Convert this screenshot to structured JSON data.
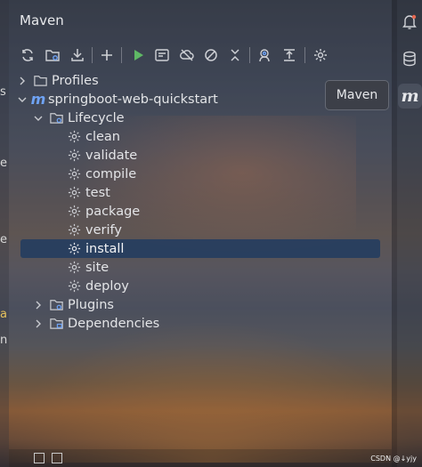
{
  "panel": {
    "title": "Maven"
  },
  "toolbar": {
    "buttons": [
      {
        "name": "reload-icon"
      },
      {
        "name": "generate-sources-icon"
      },
      {
        "name": "download-icon"
      },
      {
        "name": "add-icon"
      },
      {
        "name": "run-icon"
      },
      {
        "name": "execute-goal-icon"
      },
      {
        "name": "offline-mode-icon"
      },
      {
        "name": "skip-tests-icon"
      },
      {
        "name": "collapse-icon"
      },
      {
        "name": "show-dependencies-icon"
      },
      {
        "name": "expand-icon"
      },
      {
        "name": "settings-icon"
      }
    ]
  },
  "tree": {
    "profiles": "Profiles",
    "project": "springboot-web-quickstart",
    "lifecycle": "Lifecycle",
    "goals": [
      "clean",
      "validate",
      "compile",
      "test",
      "package",
      "verify",
      "install",
      "site",
      "deploy"
    ],
    "selected_goal": "install",
    "plugins": "Plugins",
    "dependencies": "Dependencies"
  },
  "tooltip": {
    "text": "Maven"
  },
  "left_edge": {
    "chars": [
      "s",
      "e",
      "ev",
      "e",
      "a",
      "n"
    ]
  },
  "footer": {
    "watermark": "CSDN @↓yjy"
  },
  "colors": {
    "accent_blue": "#4a8cf0",
    "run_green": "#5fb865",
    "selection": "#1f3a60",
    "text": "#e3e4e7"
  }
}
